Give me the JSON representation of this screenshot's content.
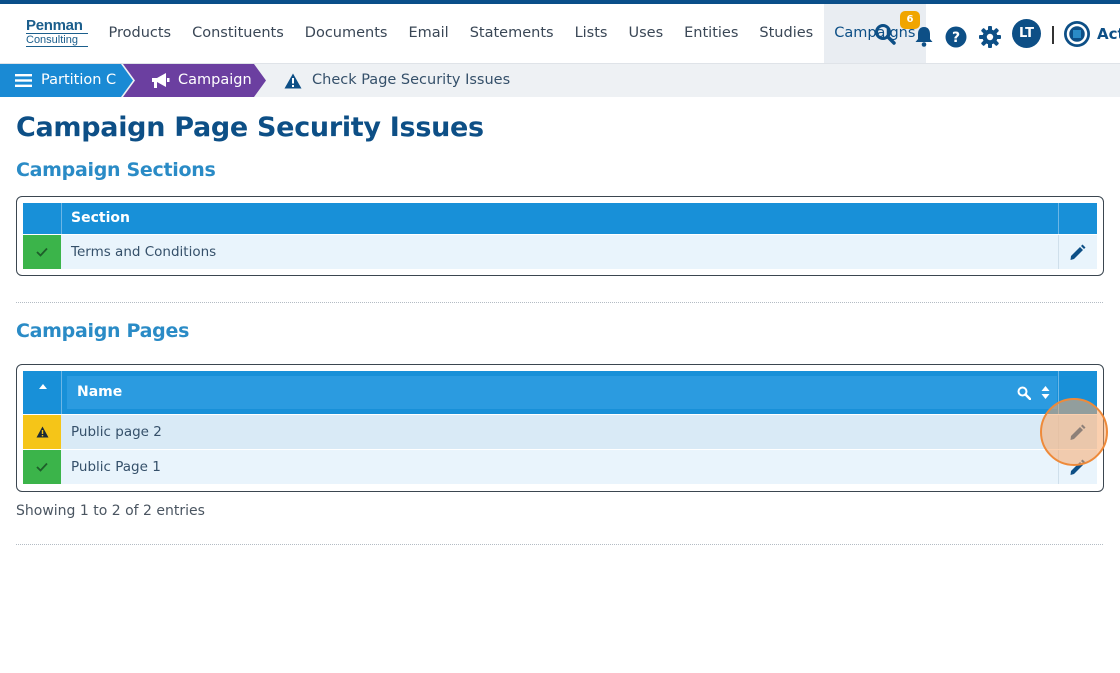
{
  "brand": {
    "logo_line1": "Penman",
    "logo_line2": "Consulting",
    "partial_label": "Act"
  },
  "nav": {
    "items": [
      {
        "label": "Products"
      },
      {
        "label": "Constituents"
      },
      {
        "label": "Documents"
      },
      {
        "label": "Email"
      },
      {
        "label": "Statements"
      },
      {
        "label": "Lists"
      },
      {
        "label": "Uses"
      },
      {
        "label": "Entities"
      },
      {
        "label": "Studies"
      },
      {
        "label": "Campaigns",
        "active": true
      }
    ],
    "notification_count": "6",
    "user_initials": "LT"
  },
  "breadcrumb": {
    "partition": "Partition C",
    "campaign": "Campaign",
    "current": "Check Page Security Issues"
  },
  "page": {
    "title": "Campaign Page Security Issues"
  },
  "sections": {
    "title": "Campaign Sections",
    "header": "Section",
    "rows": [
      {
        "status": "ok",
        "label": "Terms and Conditions"
      }
    ]
  },
  "pages": {
    "title": "Campaign Pages",
    "header": "Name",
    "rows": [
      {
        "status": "warning",
        "label": "Public page 2"
      },
      {
        "status": "ok",
        "label": "Public Page 1"
      }
    ],
    "info": "Showing 1 to 2 of 2 entries"
  },
  "colors": {
    "brand_dark": "#0d4f86",
    "header_blue": "#1890d8",
    "section_blue": "#2a8bc6",
    "ok_green": "#3bb44a",
    "warn_yellow": "#f5c518",
    "campaign_purple": "#6b3fa0",
    "partition_blue": "#1a8ad4"
  }
}
